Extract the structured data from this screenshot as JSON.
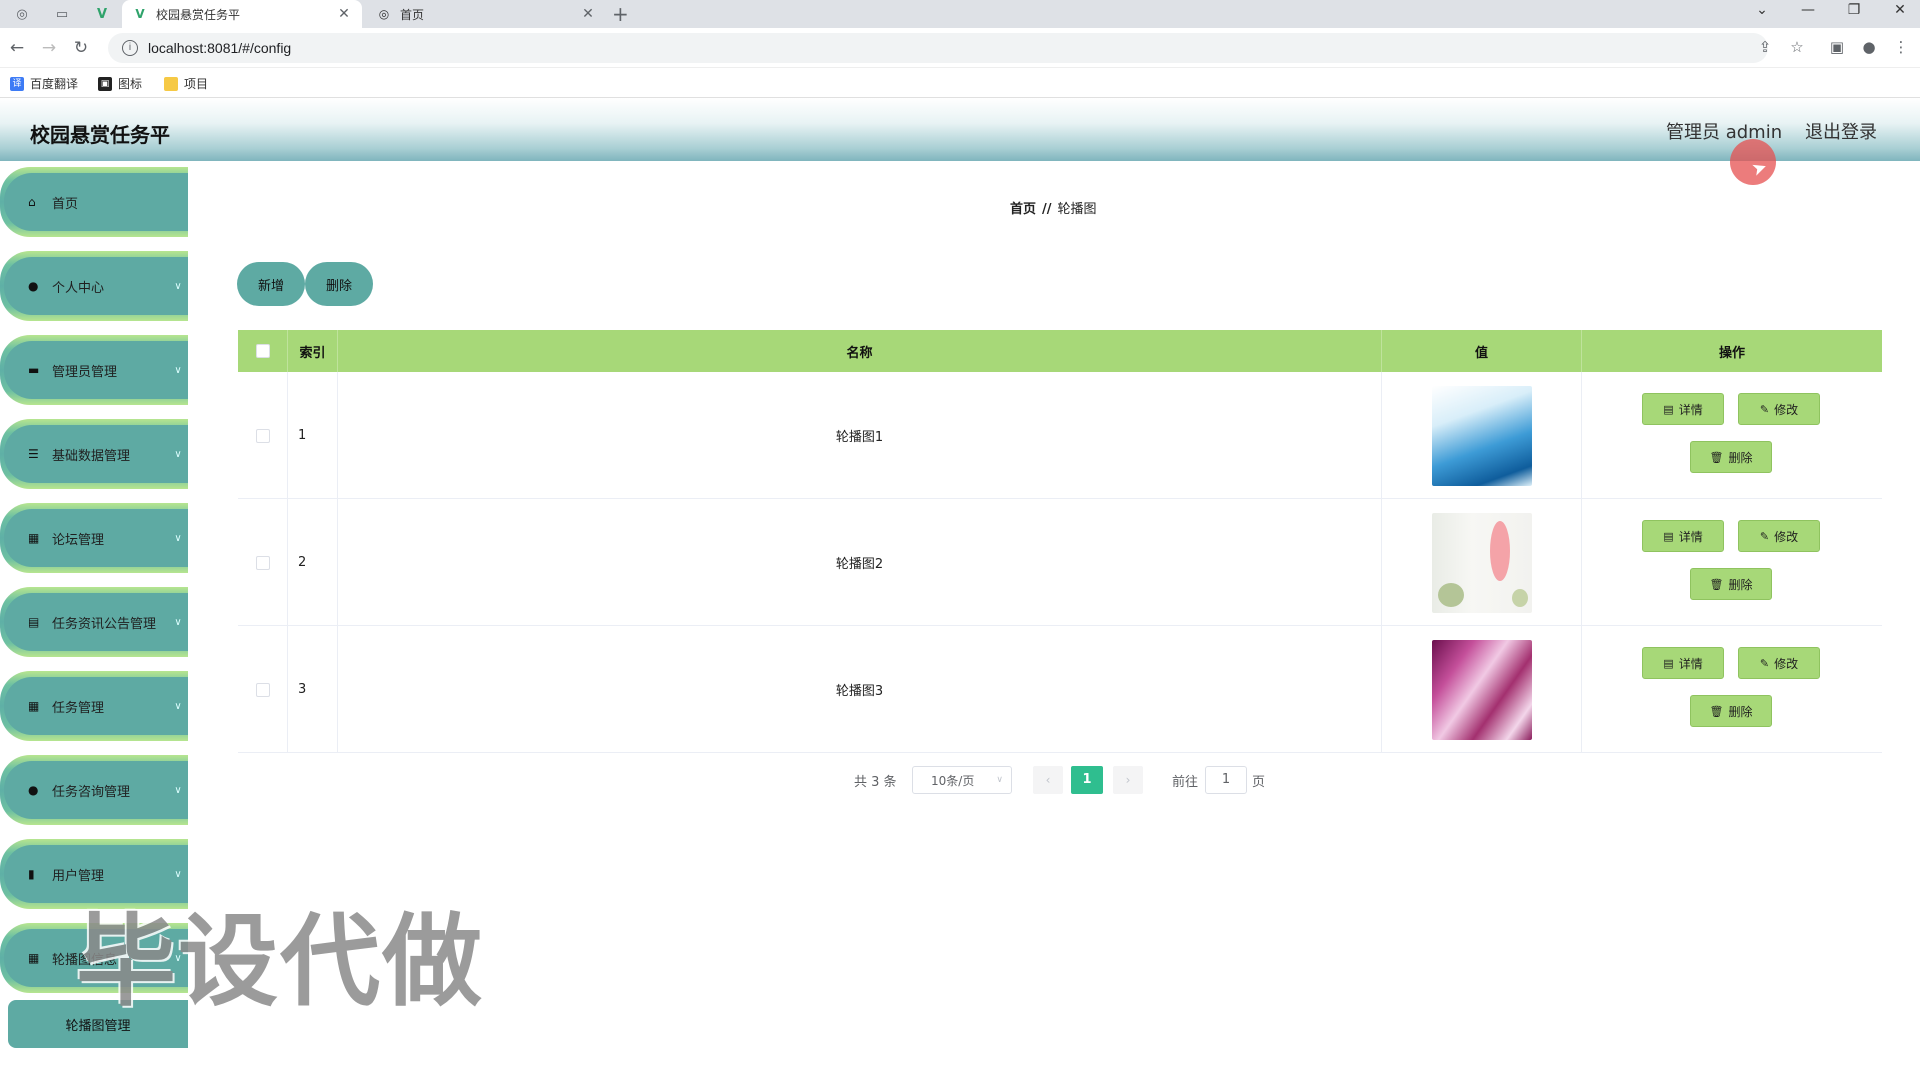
{
  "browser": {
    "tabs": [
      {
        "title": "校园悬赏任务平"
      },
      {
        "title": "首页"
      }
    ],
    "url": "localhost:8081/#/config",
    "bookmarks": [
      {
        "label": "百度翻译"
      },
      {
        "label": "图标"
      },
      {
        "label": "项目"
      }
    ]
  },
  "header": {
    "title": "校园悬赏任务平",
    "admin": "管理员 admin",
    "logout": "退出登录"
  },
  "sidebar": {
    "items": [
      {
        "label": "首页",
        "icon": "home-icon"
      },
      {
        "label": "个人中心",
        "icon": "user-icon"
      },
      {
        "label": "管理员管理",
        "icon": "chat-icon"
      },
      {
        "label": "基础数据管理",
        "icon": "list-icon"
      },
      {
        "label": "论坛管理",
        "icon": "grid-icon"
      },
      {
        "label": "任务资讯公告管理",
        "icon": "calendar-icon"
      },
      {
        "label": "任务管理",
        "icon": "grid-icon"
      },
      {
        "label": "任务咨询管理",
        "icon": "location-icon"
      },
      {
        "label": "用户管理",
        "icon": "bar-chart-icon"
      },
      {
        "label": "轮播图信息",
        "icon": "grid-icon"
      }
    ],
    "sub_item": "轮播图管理"
  },
  "breadcrumb": {
    "home": "首页",
    "sep": "//",
    "current": "轮播图"
  },
  "actions": {
    "add": "新增",
    "delete": "删除"
  },
  "table": {
    "headers": {
      "index": "索引",
      "name": "名称",
      "value": "值",
      "ops": "操作"
    },
    "rows": [
      {
        "index": "1",
        "name": "轮播图1",
        "thumb": "blue-water-splash"
      },
      {
        "index": "2",
        "name": "轮播图2",
        "thumb": "white-interior-pink"
      },
      {
        "index": "3",
        "name": "轮播图3",
        "thumb": "purple-fabric"
      }
    ],
    "row_buttons": {
      "detail": "详情",
      "edit": "修改",
      "delete": "删除"
    }
  },
  "pagination": {
    "total": "共 3 条",
    "page_size": "10条/页",
    "current_page": "1",
    "goto_label": "前往",
    "goto_value": "1",
    "page_unit": "页"
  },
  "watermark": "毕设代做",
  "colors": {
    "accent_green": "#a7d878",
    "teal": "#5eaaa3",
    "active_page": "#2fbe8f"
  }
}
